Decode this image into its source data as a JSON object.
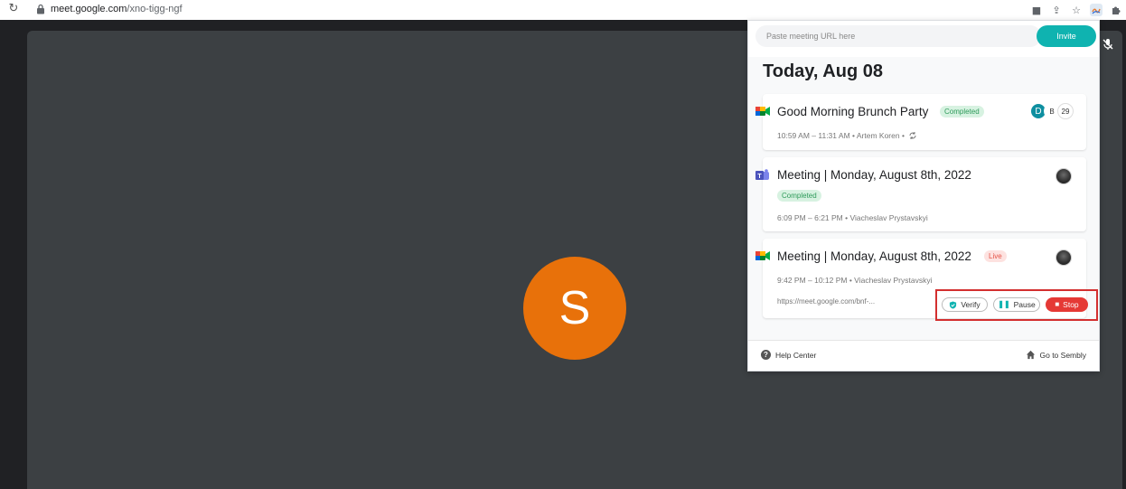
{
  "browser": {
    "url_host": "meet.google.com",
    "url_path": "/xno-tigg-ngf",
    "extensions": [
      {
        "name": "camera-icon",
        "glyph": "■"
      },
      {
        "name": "share-icon",
        "glyph": "⇪"
      },
      {
        "name": "star-icon",
        "glyph": "☆"
      },
      {
        "name": "sembly-extension-icon",
        "glyph": "≋"
      },
      {
        "name": "puzzle-icon",
        "glyph": "✚"
      }
    ]
  },
  "meet": {
    "avatar_initial": "S"
  },
  "popup": {
    "url_placeholder": "Paste meeting URL here",
    "invite_label": "Invite",
    "date_heading": "Today, Aug 08",
    "cards": [
      {
        "platform": "google-meet",
        "title": "Good Morning Brunch Party",
        "badge": "Completed",
        "meta": "10:59 AM – 11:31 AM  •  Artem Koren  •",
        "participants": [
          "D",
          "B",
          "29"
        ]
      },
      {
        "platform": "ms-teams",
        "title": "Meeting | Monday, August 8th, 2022",
        "badge": "Completed",
        "meta": "6:09 PM – 6:21 PM  •  Viacheslav Prystavskyi"
      },
      {
        "platform": "google-meet",
        "title": "Meeting | Monday, August 8th, 2022",
        "badge": "Live",
        "meta": "9:42 PM – 10:12 PM  •  Viacheslav Prystavskyi",
        "link": "https://meet.google.com/bnf-...",
        "controls": {
          "verify": "Verify",
          "pause": "Pause",
          "stop": "Stop"
        }
      }
    ],
    "footer": {
      "help": "Help Center",
      "go": "Go to Sembly"
    }
  },
  "colors": {
    "accent_teal": "#0fb3b0",
    "stop_red": "#e53935",
    "highlight_box": "#d32f2f",
    "meet_orange": "#e8710a"
  }
}
